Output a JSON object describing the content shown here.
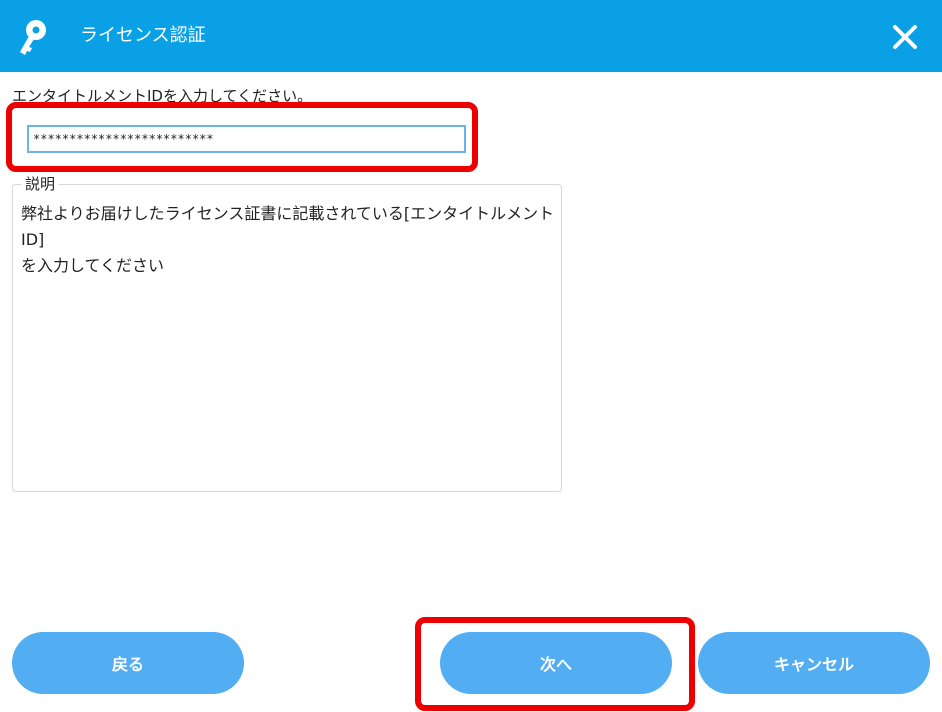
{
  "window": {
    "title": "ライセンス認証",
    "icon": "key-icon",
    "close_icon": "close-icon"
  },
  "form": {
    "prompt": "エンタイトルメントIDを入力してください。",
    "entitlement_id_value": "*************************"
  },
  "description": {
    "legend": "説明",
    "text_line1": "弊社よりお届けしたライセンス証書に記載されている[エンタイトルメントID]",
    "text_line2": "を入力してください"
  },
  "buttons": {
    "back_label": "戻る",
    "next_label": "次へ",
    "cancel_label": "キャンセル"
  },
  "colors": {
    "titlebar": "#0aa0e6",
    "button": "#52adf2",
    "highlight": "#ee0000"
  }
}
